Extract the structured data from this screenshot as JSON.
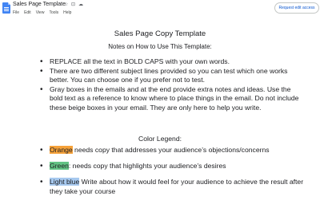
{
  "app": {
    "doc_title": "Sales Page Template",
    "star_icon": "star-icon",
    "move_icon": "folder-icon",
    "cloud_icon": "cloud-status-icon",
    "menu": [
      "File",
      "Edit",
      "View",
      "Tools",
      "Help"
    ],
    "request_button": "Request edit access"
  },
  "doc": {
    "heading": "Sales Page Copy Template",
    "subheading": "Notes on How to Use This Template:",
    "notes": [
      "REPLACE all the text in BOLD CAPS with your own words.",
      "There are two different subject lines provided so you can test which one works better. You can choose one if you prefer not to test.",
      "Gray boxes in the emails and at the end provide extra notes and ideas. Use the bold text as a reference to know where to place things in the email. Do not include these beige boxes in your email. They are only here to help you write."
    ],
    "legend_title": "Color Legend:",
    "legend": [
      {
        "term": "Orange",
        "text": " needs copy that addresses your audience’s objections/concerns"
      },
      {
        "term": "Green",
        "text": ": needs copy that highlights your audience’s desires"
      },
      {
        "term": "Light blue",
        "text": " Write about how it would feel for your audience to achieve the result after they take your course"
      }
    ]
  },
  "colors": {
    "orange": "#f6a23a",
    "green": "#63c384",
    "light_blue": "#a7c9ef",
    "accent": "#0b57d0",
    "docs_blue": "#4285f4"
  }
}
